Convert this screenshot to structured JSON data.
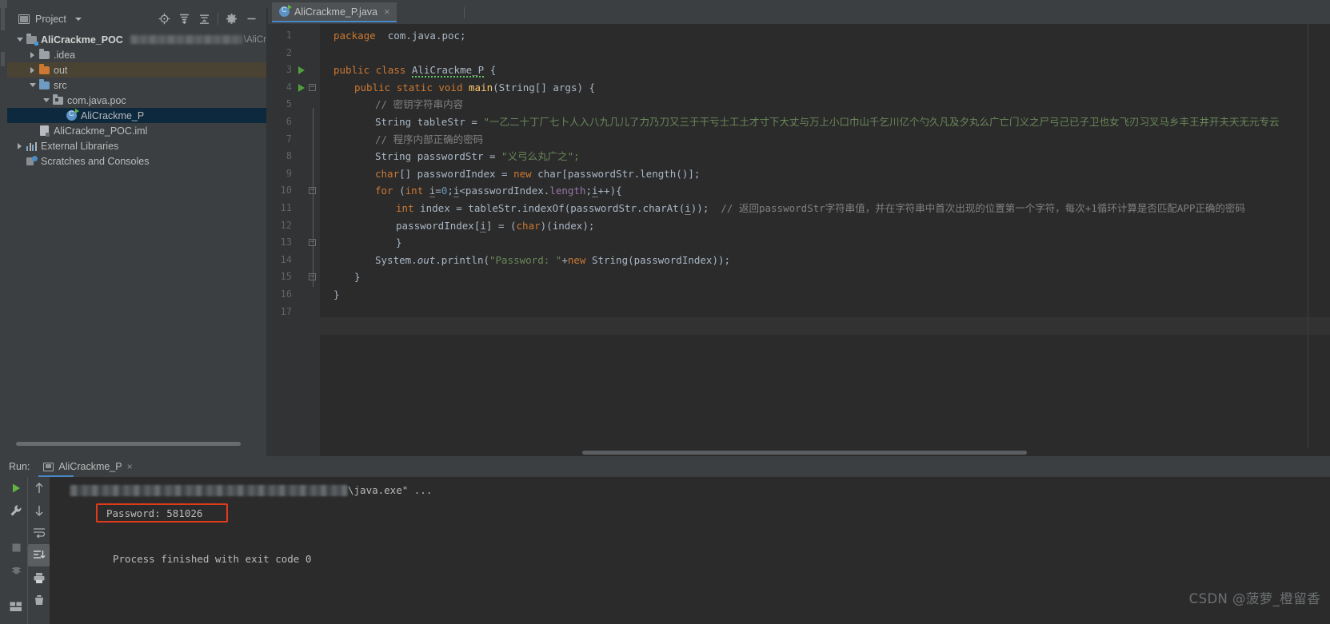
{
  "window": {
    "top_right_label": "AliCrackme_POC"
  },
  "project_panel": {
    "title": "Project",
    "title_icon": "project-window-icon",
    "actions": [
      {
        "name": "locate-icon",
        "label": ""
      },
      {
        "name": "expand-all-icon",
        "label": ""
      },
      {
        "name": "collapse-all-icon",
        "label": ""
      },
      {
        "name": "gear-icon",
        "label": ""
      },
      {
        "name": "hide-icon",
        "label": ""
      }
    ],
    "tree": [
      {
        "label": "AliCrackme_POC",
        "icon": "module-folder-icon",
        "indent": 0,
        "twist": "down",
        "bold": true,
        "selected": false,
        "highlight": "none",
        "path_blurred": true,
        "path_tail": "\\AliCr"
      },
      {
        "label": ".idea",
        "icon": "folder-gray-icon",
        "indent": 1,
        "twist": "right",
        "bold": false,
        "selected": false,
        "highlight": "none"
      },
      {
        "label": "out",
        "icon": "folder-orange-icon",
        "indent": 1,
        "twist": "right",
        "bold": false,
        "selected": false,
        "highlight": "out"
      },
      {
        "label": "src",
        "icon": "folder-blue-icon",
        "indent": 1,
        "twist": "down",
        "bold": false,
        "selected": false,
        "highlight": "none"
      },
      {
        "label": "com.java.poc",
        "icon": "package-icon",
        "indent": 2,
        "twist": "down",
        "bold": false,
        "selected": false,
        "highlight": "none"
      },
      {
        "label": "AliCrackme_P",
        "icon": "java-class-icon",
        "indent": 3,
        "twist": "none",
        "bold": false,
        "selected": true,
        "highlight": "none"
      },
      {
        "label": "AliCrackme_POC.iml",
        "icon": "iml-file-icon",
        "indent": 1,
        "twist": "none",
        "bold": false,
        "selected": false,
        "highlight": "none"
      },
      {
        "label": "External Libraries",
        "icon": "libraries-icon",
        "indent": 0,
        "twist": "right",
        "bold": false,
        "selected": false,
        "highlight": "none"
      },
      {
        "label": "Scratches and Consoles",
        "icon": "scratches-icon",
        "indent": 0,
        "twist": "none",
        "bold": false,
        "selected": false,
        "highlight": "none"
      }
    ]
  },
  "editor": {
    "tab": {
      "name": "AliCrackme_P.java",
      "icon": "java-class-icon",
      "close": "×"
    },
    "lines": [
      {
        "n": "1",
        "run": false,
        "fold": "none"
      },
      {
        "n": "2",
        "run": false,
        "fold": "none"
      },
      {
        "n": "3",
        "run": true,
        "fold": "none"
      },
      {
        "n": "4",
        "run": true,
        "fold": "minus"
      },
      {
        "n": "5",
        "run": false,
        "fold": "none"
      },
      {
        "n": "6",
        "run": false,
        "fold": "none"
      },
      {
        "n": "7",
        "run": false,
        "fold": "none"
      },
      {
        "n": "8",
        "run": false,
        "fold": "none"
      },
      {
        "n": "9",
        "run": false,
        "fold": "none"
      },
      {
        "n": "10",
        "run": false,
        "fold": "minus"
      },
      {
        "n": "11",
        "run": false,
        "fold": "none"
      },
      {
        "n": "12",
        "run": false,
        "fold": "none"
      },
      {
        "n": "13",
        "run": false,
        "fold": "end"
      },
      {
        "n": "14",
        "run": false,
        "fold": "none"
      },
      {
        "n": "15",
        "run": false,
        "fold": "end"
      },
      {
        "n": "16",
        "run": false,
        "fold": "none"
      },
      {
        "n": "17",
        "run": false,
        "fold": "none"
      }
    ],
    "code": {
      "l1_package_kw": "package",
      "l1_name": "com.java.poc;",
      "l3_public": "public",
      "l3_class": "class",
      "l3_name": "AliCrackme_P",
      "l3_brace": "{",
      "l4_public": "public",
      "l4_static": "static",
      "l4_void": "void",
      "l4_main": "main",
      "l4_args": "(String[] args) {",
      "l5_comment": "// 密钥字符串内容",
      "l6_type": "String",
      "l6_var": "tableStr = ",
      "l6_string": "\"一乙二十丁厂七卜人入八九几儿了力乃刀又三于干亏士工土才寸下大丈与万上小口巾山千乞川亿个勺久凡及夕丸么广亡门义之尸弓己已子卫也女飞刃习叉马乡丰王井开夫天无元专云",
      "l7_comment": "// 程序内部正确的密码",
      "l8_type": "String",
      "l8_var": "passwordStr = ",
      "l8_string": "\"义弓么丸广之\";",
      "l9_type": "char",
      "l9_decl": "[] passwordIndex = ",
      "l9_new": "new",
      "l9_rest": "char[passwordStr.length()];",
      "l10_for": "for",
      "l10_a": "(",
      "l10_int": "int",
      "l10_i": "i",
      "l10_eq": "=",
      "l10_zero": "0",
      "l10_semi": ";",
      "l10_i2": "i",
      "l10_lt": "<passwordIndex.",
      "l10_len": "length",
      "l10_semi2": ";",
      "l10_i3": "i",
      "l10_inc": "++){",
      "l11_int": "int",
      "l11_expr": " index = tableStr.indexOf(passwordStr.charAt(",
      "l11_i": "i",
      "l11_end": "));",
      "l11_comment": "// 返回passwordStr字符串值，并在字符串中首次出现的位置第一个字符，",
      "l11_comment2": "每次+1循环计算是否匹配APP正确的密码",
      "l12_a": "passwordIndex[",
      "l12_i": "i",
      "l12_b": "] = (",
      "l12_char": "char",
      "l12_c": ")(index);",
      "l13_brace": "}",
      "l14_sys": "System.",
      "l14_out": "out",
      "l14_println": ".println(",
      "l14_str": "\"Password: \"",
      "l14_plus": "+",
      "l14_new": "new",
      "l14_rest": " String(passwordIndex));",
      "l15_brace": "}",
      "l16_brace": "}"
    }
  },
  "run_panel": {
    "label": "Run:",
    "tab_name": "AliCrackme_P",
    "tab_icon": "run-config-icon",
    "tab_close": "×",
    "toolbar_left": [
      {
        "name": "rerun-icon"
      },
      {
        "name": "wrench-settings-icon"
      },
      {
        "name": "stop-icon"
      },
      {
        "name": "stop-debug-icon"
      },
      {
        "name": "layout-icon"
      }
    ],
    "toolbar_right": [
      {
        "name": "scroll-up-icon"
      },
      {
        "name": "scroll-down-icon"
      },
      {
        "name": "soft-wrap-icon"
      },
      {
        "name": "scroll-to-end-icon",
        "active": true
      },
      {
        "name": "print-icon"
      },
      {
        "name": "clear-all-icon"
      }
    ],
    "console": {
      "command_tail": "\\java.exe\" ...",
      "password_line": "Password: 581026",
      "exit_line": "Process finished with exit code 0",
      "highlight_color": "#e03a1b"
    }
  },
  "watermark": "CSDN @菠萝_橙留香"
}
